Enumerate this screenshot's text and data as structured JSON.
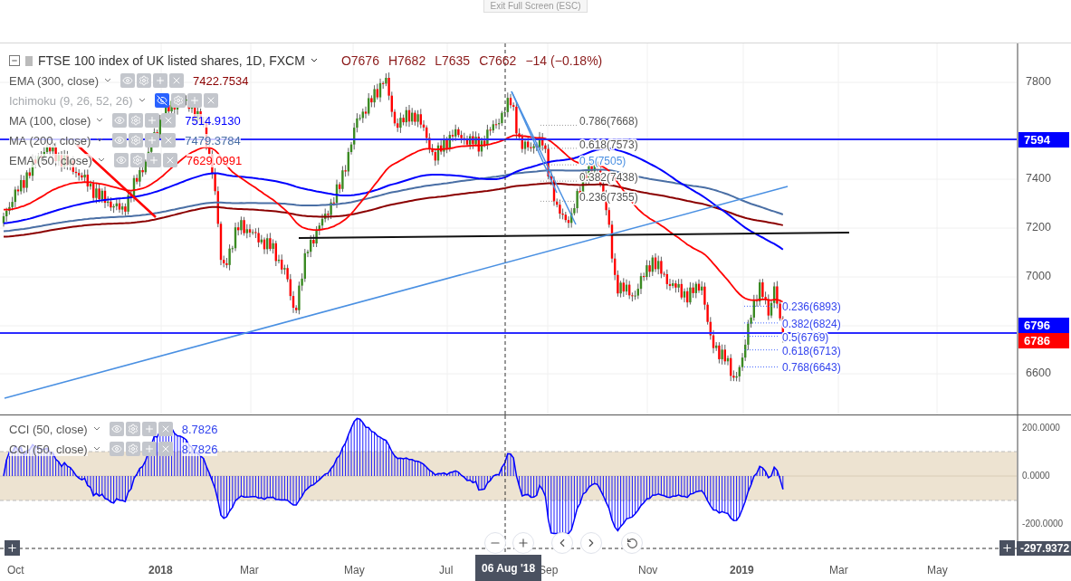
{
  "tooltip": "Exit Full Screen (ESC)",
  "legend": {
    "title": "FTSE 100 index of UK listed shares, 1D, FXCM",
    "ohlc": [
      "O7676",
      "H7682",
      "L7635",
      "C7662",
      "−14 (−0.18%)"
    ],
    "indicators": [
      {
        "name": "EMA (300, close)",
        "value": "7422.7534",
        "color": "#8b0000",
        "visible": true
      },
      {
        "name": "Ichimoku (9, 26, 52, 26)",
        "visible": false
      },
      {
        "name": "MA (100, close)",
        "value": "7514.9130",
        "color": "#0000ff",
        "visible": true
      },
      {
        "name": "MA (200, close)",
        "value": "7479.3784",
        "color": "#4a6fa5",
        "visible": true
      },
      {
        "name": "EMA (50, close)",
        "value": "7629.0991",
        "color": "#ff0000",
        "visible": true
      }
    ]
  },
  "fib_upper": [
    "0.786(7668)",
    "0.618(7573)",
    "0.5(7505)",
    "0.382(7438)",
    "0.236(7355)"
  ],
  "fib_lower": [
    "0.236(6893)",
    "0.382(6824)",
    "0.5(6769)",
    "0.618(6713)",
    "0.768(6643)"
  ],
  "price_axis": {
    "ticks": [
      "7800",
      "7400",
      "7200",
      "7000",
      "6600"
    ],
    "labels": [
      {
        "text": "7594",
        "color": "#0000ff"
      },
      {
        "text": "6796",
        "color": "#0000ff"
      },
      {
        "text": "6786",
        "color": "#ff0000"
      }
    ]
  },
  "cci": {
    "indicators": [
      {
        "name": "CCI (50, close)",
        "value": "8.7826"
      },
      {
        "name": "CCI (50, close)",
        "value": "8.7826"
      }
    ],
    "ticks": [
      "200.0000",
      "0.0000",
      "-200.0000"
    ],
    "cursor_value": "-297.9372"
  },
  "time_axis": {
    "labels": [
      {
        "text": "Oct",
        "kind": "month"
      },
      {
        "text": "2018",
        "kind": "year"
      },
      {
        "text": "Mar",
        "kind": "month"
      },
      {
        "text": "May",
        "kind": "month"
      },
      {
        "text": "Jul",
        "kind": "month"
      },
      {
        "text": "Sep",
        "kind": "month"
      },
      {
        "text": "Nov",
        "kind": "month"
      },
      {
        "text": "2019",
        "kind": "year"
      },
      {
        "text": "Mar",
        "kind": "month"
      },
      {
        "text": "May",
        "kind": "month"
      }
    ],
    "cursor_date": "06 Aug '18"
  }
}
